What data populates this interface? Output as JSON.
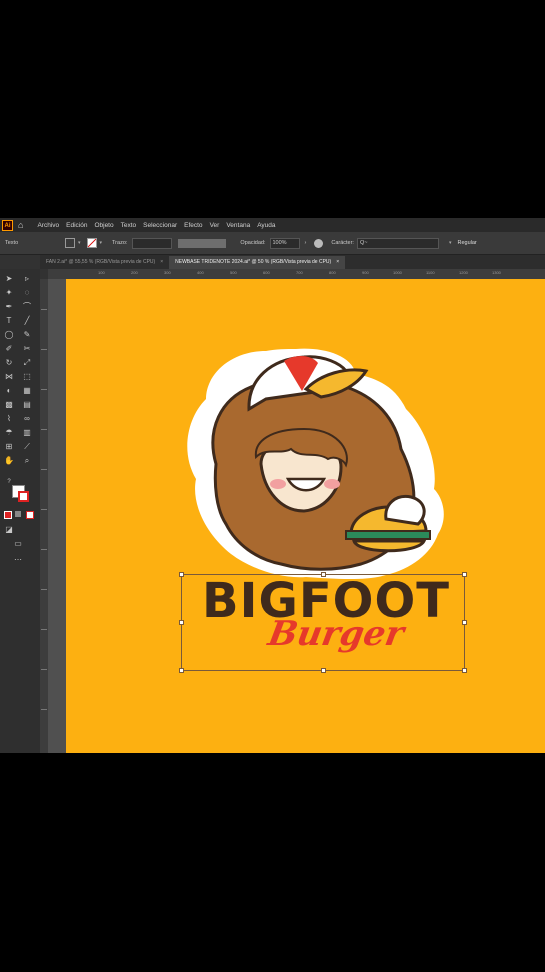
{
  "menubar": {
    "app_logo": "Ai",
    "items": [
      "Archivo",
      "Edición",
      "Objeto",
      "Texto",
      "Seleccionar",
      "Efecto",
      "Ver",
      "Ventana",
      "Ayuda"
    ]
  },
  "options_bar": {
    "selection_label": "Texto",
    "stroke_label": "Trazo:",
    "opacity_label": "Opacidad:",
    "opacity_value": "100%",
    "char_label": "Carácter:",
    "font_placeholder": "Q~",
    "font_style": "Regular"
  },
  "tabs": [
    {
      "label": "FAN 2.ai* @ 55,55 % (RGB/Vista previa de CPU)",
      "close": "×",
      "active": false
    },
    {
      "label": "NEWBASE TRIDENOTE 2024.ai* @ 50 % (RGB/Vista previa de CPU)",
      "close": "×",
      "active": true
    }
  ],
  "ruler_ticks": [
    "100",
    "200",
    "300",
    "400",
    "500",
    "600",
    "700",
    "800",
    "900",
    "1000",
    "1100",
    "1200",
    "1300"
  ],
  "logo": {
    "title": "BIGFOOT",
    "subtitle": "Burger"
  },
  "colors": {
    "artboard": "#fdb011",
    "fur": "#a9692f",
    "outline": "#3f2a1c",
    "cap": "#e6392b",
    "burger_accent": "#e6392b"
  }
}
